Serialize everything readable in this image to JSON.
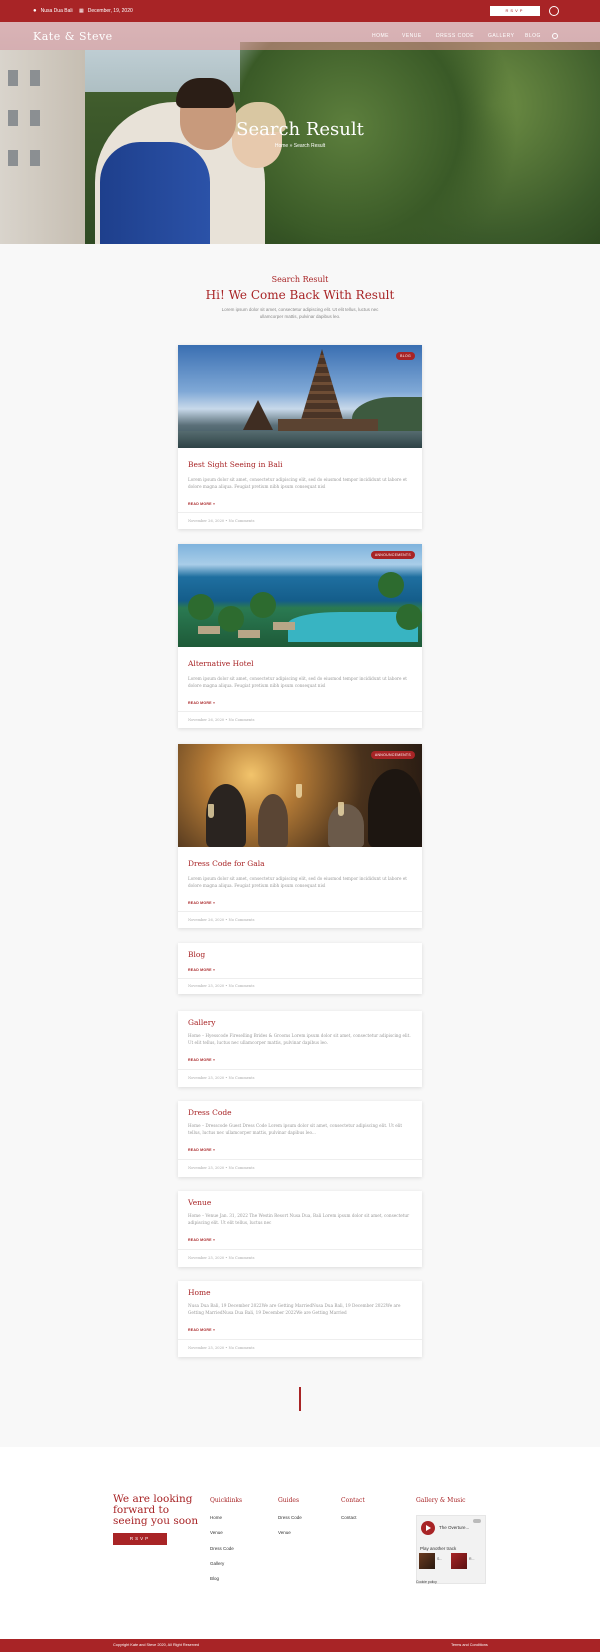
{
  "topbar": {
    "location": "Nusa Dua Bali",
    "date": "December, 19, 2020",
    "rsvp": "RSVP"
  },
  "nav": {
    "brand": "Kate & Steve",
    "items": [
      "HOME",
      "VENUE",
      "DRESS CODE",
      "GALLERY",
      "BLOG"
    ]
  },
  "hero": {
    "title": "Search Result",
    "breadcrumb": "Home » Search Result"
  },
  "heading": {
    "subtitle": "Search Result",
    "title": "Hi! We Come Back With Result",
    "description": "Lorem ipsum dolor sit amet, consectetur adipiscing elit. Ut elit tellus, luctus nec ullamcorper mattis, pulvinar dapibus leo."
  },
  "posts": [
    {
      "badge": "BLOG",
      "title": "Best Sight Seeing in Bali",
      "excerpt": "Lorem ipsum dolor sit amet, consectetur adipiscing elit, sed do eiusmod tempor incididunt ut labore et dolore magna aliqua. Feugiat pretium nibh ipsum consequat nisl",
      "more": "READ MORE »",
      "meta": "November 26, 2020  •  No Comments"
    },
    {
      "badge": "ANNOUNCEMENTS",
      "title": "Alternative Hotel",
      "excerpt": "Lorem ipsum dolor sit amet, consectetur adipiscing elit, sed do eiusmod tempor incididunt ut labore et dolore magna aliqua. Feugiat pretium nibh ipsum consequat nisl",
      "more": "READ MORE »",
      "meta": "November 26, 2020  •  No Comments"
    },
    {
      "badge": "ANNOUNCEMENTS",
      "title": "Dress Code for Gala",
      "excerpt": "Lorem ipsum dolor sit amet, consectetur adipiscing elit, sed do eiusmod tempor incididunt ut labore et dolore magna aliqua. Feugiat pretium nibh ipsum consequat nisl",
      "more": "READ MORE »",
      "meta": "November 26, 2020  •  No Comments"
    },
    {
      "title": "Blog",
      "more": "READ MORE »",
      "meta": "November 25, 2020  •  No Comments"
    },
    {
      "title": "Gallery",
      "excerpt": "Home – Hyesscode Fireselling Brides & Grooms Lorem ipsum dolor sit amet, consectetur adipiscing elit. Ut elit tellus, luctus nec ullamcorper mattis, pulvinar dapibus leo.",
      "more": "READ MORE »",
      "meta": "November 25, 2020  •  No Comments"
    },
    {
      "title": "Dress Code",
      "excerpt": "Home – Dresscode Guest Dress Code Lorem ipsum dolor sit amet, consectetur adipiscing elit. Ut elit tellus, luctus nec ullamcorper mattis, pulvinar dapibus leo...",
      "more": "READ MORE »",
      "meta": "November 25, 2020  •  No Comments"
    },
    {
      "title": "Venue",
      "excerpt": "Home – Venue Jan. 31, 2022 The Westin Resort Nusa Dua, Bali Lorem ipsum dolor sit amet, consectetur adipiscing elit. Ut elit tellus, luctus nec",
      "more": "READ MORE »",
      "meta": "November 25, 2020  •  No Comments"
    },
    {
      "title": "Home",
      "excerpt": "Nusa Dua Bali, 19 December 2022We are Getting MarriedNusa Dua Bali, 19 December 2022We are Getting MarriedNusa Dua Bali, 19 December 2022We are Getting Married",
      "more": "READ MORE »",
      "meta": "November 25, 2020  •  No Comments"
    }
  ],
  "footer": {
    "tagline": "We are looking forward to seeing you soon",
    "rsvp": "RSVP",
    "quicklinks": {
      "title": "Quicklinks",
      "links": [
        "Home",
        "Venue",
        "Dress Code",
        "Gallery",
        "Blog"
      ]
    },
    "guides": {
      "title": "Guides",
      "links": [
        "Dress Code",
        "Venue"
      ]
    },
    "contact": {
      "title": "Contact",
      "links": [
        "Contact"
      ]
    },
    "music": {
      "title": "Gallery & Music",
      "track": "The Overture...",
      "another": "Play another track",
      "thumb1": "S...",
      "thumb2": "R...",
      "cookie": "Cookie policy"
    },
    "copyright": "Copyright Kate and Steve 2020, All Right Reserved",
    "terms": "Terms and Conditions"
  },
  "colors": {
    "accent": "#a82426"
  }
}
